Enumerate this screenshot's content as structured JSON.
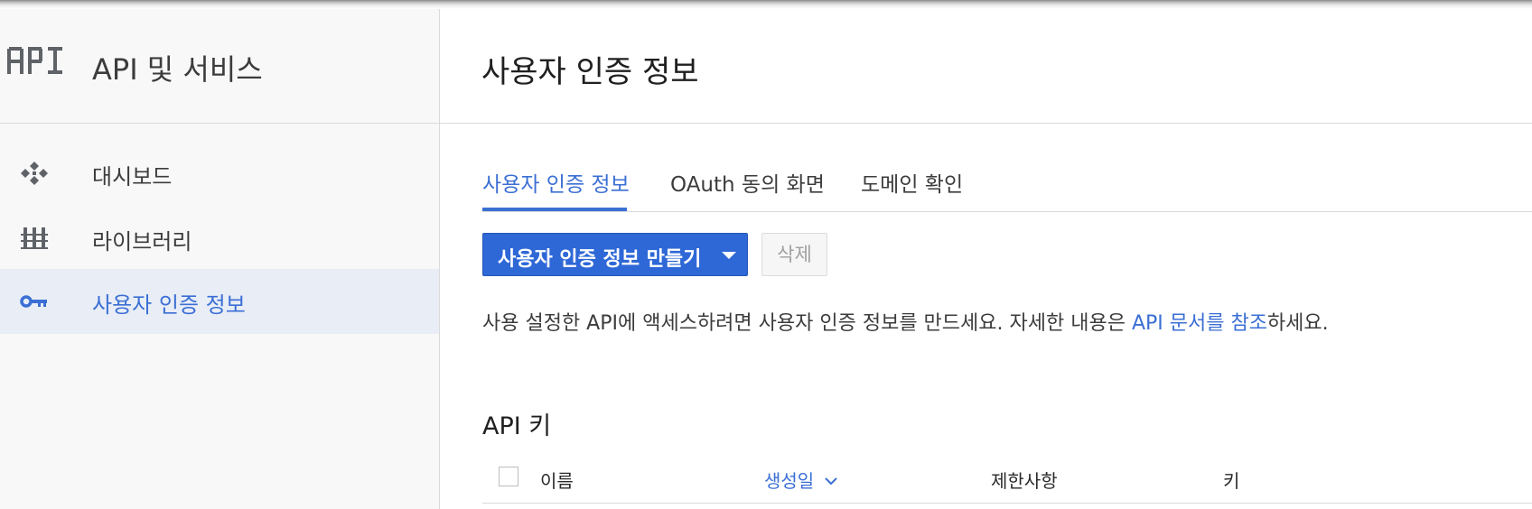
{
  "app": {
    "logo_text": "API",
    "title": "API 및 서비스"
  },
  "sidebar": {
    "items": [
      {
        "label": "대시보드",
        "icon": "dashboard-icon",
        "active": false
      },
      {
        "label": "라이브러리",
        "icon": "library-icon",
        "active": false
      },
      {
        "label": "사용자 인증 정보",
        "icon": "key-icon",
        "active": true
      }
    ]
  },
  "header": {
    "title": "사용자 인증 정보"
  },
  "tabs": [
    {
      "label": "사용자 인증 정보",
      "active": true
    },
    {
      "label": "OAuth 동의 화면",
      "active": false
    },
    {
      "label": "도메인 확인",
      "active": false
    }
  ],
  "actions": {
    "create_label": "사용자 인증 정보 만들기",
    "delete_label": "삭제"
  },
  "description": {
    "text": "사용 설정한 API에 액세스하려면 사용자 인증 정보를 만드세요. 자세한 내용은 ",
    "link": "API 문서를 참조",
    "suffix": "하세요."
  },
  "api_keys": {
    "title": "API 키",
    "columns": [
      "이름",
      "생성일",
      "제한사항",
      "키"
    ],
    "sorted_column": "생성일"
  },
  "colors": {
    "accent": "#3b6fd4",
    "primary_button": "#2e68d7",
    "active_nav_bg": "#e8edf6"
  }
}
